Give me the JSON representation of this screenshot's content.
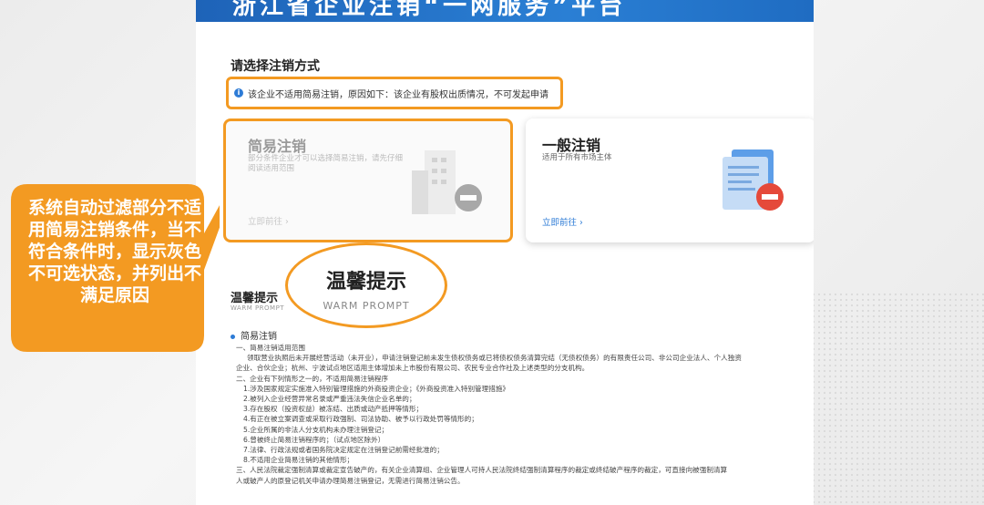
{
  "banner": {
    "title": "浙江省企业注销“一网服务”平台"
  },
  "choose": {
    "title": "请选择注销方式"
  },
  "notice": {
    "text": "该企业不适用简易注销，原因如下：该企业有股权出质情况，不可发起申请"
  },
  "cards": {
    "simple": {
      "title": "简易注销",
      "desc": "部分条件企业才可以选择简易注销，请先仔细阅读适用范围",
      "link": "立即前往 ›"
    },
    "general": {
      "title": "一般注销",
      "desc": "适用于所有市场主体",
      "link": "立即前往 ›"
    }
  },
  "tips": {
    "title": "温馨提示",
    "subtitle": "WARM PROMPT",
    "circle_title": "温馨提示",
    "circle_subtitle": "WARM PROMPT",
    "section": "简易注销",
    "lines": [
      "一、简易注销适用范围",
      "领取营业执照后未开展经营活动（未开业），申请注销登记前未发生债权债务或已将债权债务清算完结（无债权债务）的有限责任公司、非公司企业法人、个人独资",
      "企业、合伙企业；杭州、宁波试点地区适用主体增加未上市股份有限公司、农民专业合作社及上述类型的分支机构。",
      "二、企业有下列情形之一的，不适用简易注销程序",
      "1.涉及国家规定实施准入特别管理措施的外商投资企业；《外商投资准入特别管理措施》",
      "2.被列入企业经营异常名录或严重违法失信企业名单的；",
      "3.存在股权（投资权益）被冻结、出质或动产抵押等情形；",
      "4.有正在被立案调查或采取行政强制、司法协助、被予以行政处罚等情形的；",
      "5.企业所属的非法人分支机构未办理注销登记；",
      "6.曾被终止简易注销程序的；（试点地区除外）",
      "7.法律、行政法规或者国务院决定规定在注销登记前需经批准的；",
      "8.不适用企业简易注销的其他情形；",
      "三、人民法院裁定强制清算或裁定宣告破产的，有关企业清算组、企业管理人可持人民法院终结强制清算程序的裁定或终结破产程序的裁定，可直接向被强制清算",
      "人或破产人的原登记机关申请办理简易注销登记，无需进行简易注销公告。"
    ]
  },
  "callout": {
    "text": "系统自动过滤部分不适用简易注销条件，当不符合条件时，显示灰色不可选状态，并列出不满足原因"
  },
  "colors": {
    "accent": "#f39a22",
    "brand": "#2d7bd6",
    "warning_red": "#e02020"
  }
}
